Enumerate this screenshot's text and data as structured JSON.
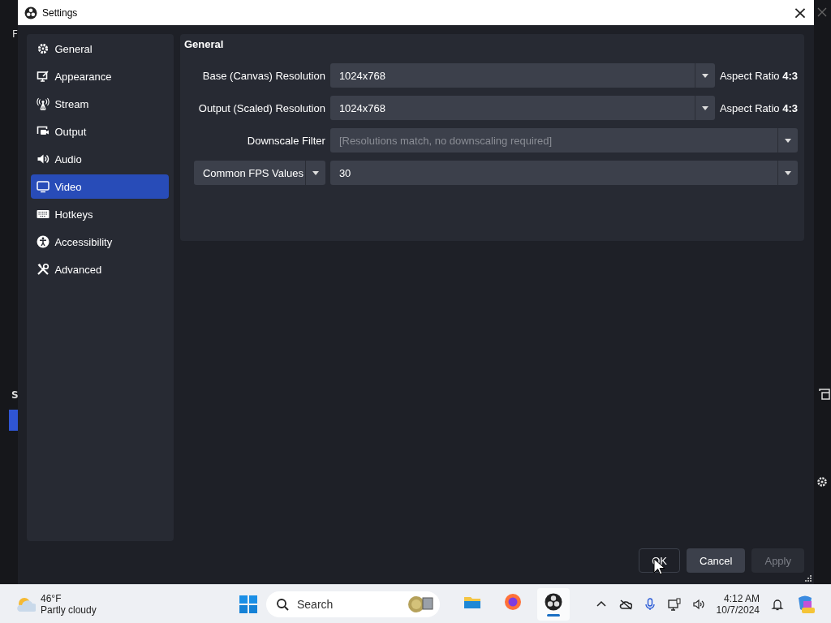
{
  "background": {
    "texts": [
      "F",
      "S"
    ]
  },
  "window": {
    "title": "Settings",
    "close": "×"
  },
  "sidebar": {
    "items": [
      {
        "label": "General",
        "selected": false
      },
      {
        "label": "Appearance",
        "selected": false
      },
      {
        "label": "Stream",
        "selected": false
      },
      {
        "label": "Output",
        "selected": false
      },
      {
        "label": "Audio",
        "selected": false
      },
      {
        "label": "Video",
        "selected": true
      },
      {
        "label": "Hotkeys",
        "selected": false
      },
      {
        "label": "Accessibility",
        "selected": false
      },
      {
        "label": "Advanced",
        "selected": false
      }
    ]
  },
  "section": {
    "title": "General",
    "rows": [
      {
        "kind": "combo",
        "label": "Base (Canvas) Resolution",
        "value": "1024x768",
        "disabled": false,
        "note": "Aspect Ratio **4:3**"
      },
      {
        "kind": "combo",
        "label": "Output (Scaled) Resolution",
        "value": "1024x768",
        "disabled": false,
        "note": "Aspect Ratio **4:3**"
      },
      {
        "kind": "combo",
        "label": "Downscale Filter",
        "value": "[Resolutions match, no downscaling required]",
        "disabled": true
      },
      {
        "kind": "fps",
        "label": "Common FPS Values",
        "value": "30",
        "disabled": false
      }
    ]
  },
  "buttons": [
    {
      "label": "OK",
      "default": true,
      "disabled": false
    },
    {
      "label": "Cancel",
      "default": false,
      "disabled": false
    },
    {
      "label": "Apply",
      "default": false,
      "disabled": true
    }
  ],
  "taskbar": {
    "weather": {
      "temp": "46°F",
      "condition": "Partly cloudy"
    },
    "search": {
      "placeholder": "Search"
    },
    "apps": [
      {
        "active": false
      },
      {
        "active": false
      },
      {
        "active": true
      }
    ],
    "time": "4:12 AM",
    "date": "10/7/2024"
  }
}
